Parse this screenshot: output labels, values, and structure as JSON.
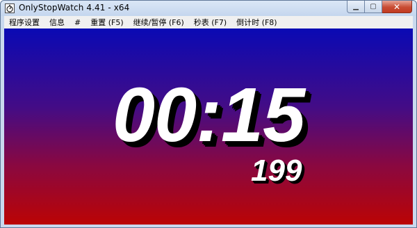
{
  "window": {
    "title": "OnlyStopWatch 4.41 - x64",
    "controls": {
      "minimize": "▁",
      "maximize": "▢",
      "close": "✕"
    }
  },
  "menu": {
    "items": [
      "程序设置",
      "信息",
      "#",
      "重置 (F5)",
      "继续/暂停 (F6)",
      "秒表 (F7)",
      "倒计时 (F8)"
    ]
  },
  "display": {
    "time": "00:15",
    "milliseconds": "199"
  },
  "colors": {
    "gradient_top": "#0a0ab4",
    "gradient_bottom": "#bb0404",
    "digits": "#ffffff",
    "digit_shadow": "#000000"
  },
  "icons": {
    "app": "stopwatch-app-icon"
  }
}
